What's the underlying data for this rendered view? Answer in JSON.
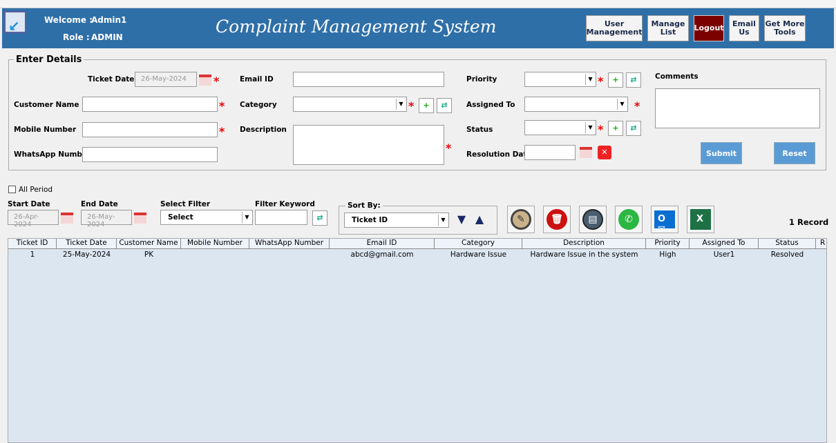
{
  "header": {
    "welcome_label": "Welcome :",
    "welcome_value": "Admin1",
    "role_label": "Role :",
    "role_value": "ADMIN",
    "title": "Complaint Management System",
    "buttons": [
      "User Management",
      "Manage List",
      "Logout",
      "Email Us",
      "Get More Tools"
    ]
  },
  "form": {
    "group_title": "Enter Details",
    "ticket_date_label": "Ticket Date",
    "ticket_date_value": "26-May-2024",
    "customer_name_label": "Customer Name",
    "mobile_label": "Mobile Number",
    "whatsapp_label": "WhatsApp Number",
    "email_label": "Email ID",
    "category_label": "Category",
    "description_label": "Description",
    "priority_label": "Priority",
    "assigned_label": "Assigned To",
    "status_label": "Status",
    "resolution_label": "Resolution Date",
    "comments_label": "Comments",
    "submit": "Submit",
    "reset": "Reset",
    "asterisk": "*",
    "plus": "+"
  },
  "filter": {
    "all_period": "All Period",
    "start_label": "Start Date",
    "start_value": "26-Apr-2024",
    "end_label": "End Date",
    "end_value": "26-May-2024",
    "select_filter_label": "Select Filter",
    "select_filter_value": "Select",
    "keyword_label": "Filter Keyword",
    "sort_label": "Sort By:",
    "sort_value": "Ticket ID",
    "record_count": "1 Record"
  },
  "table": {
    "columns": [
      "Ticket ID",
      "Ticket Date",
      "Customer Name",
      "Mobile Number",
      "WhatsApp Number",
      "Email ID",
      "Category",
      "Description",
      "Priority",
      "Assigned To",
      "Status",
      "R"
    ],
    "rows": [
      [
        "1",
        "25-May-2024",
        "PK",
        "",
        "",
        "abcd@gmail.com",
        "Hardware Issue",
        "Hardware Issue in the system",
        "High",
        "User1",
        "Resolved",
        ""
      ]
    ]
  },
  "colors": {
    "header": "#2f6fa7",
    "logout": "#7b0000",
    "button": "#5b9bd5",
    "table_bg": "#dce6f1"
  },
  "icons": [
    "edit-icon",
    "delete-icon",
    "report-icon",
    "whatsapp-icon",
    "outlook-icon",
    "excel-icon",
    "refresh-icon",
    "calendar-icon",
    "clear-icon"
  ]
}
